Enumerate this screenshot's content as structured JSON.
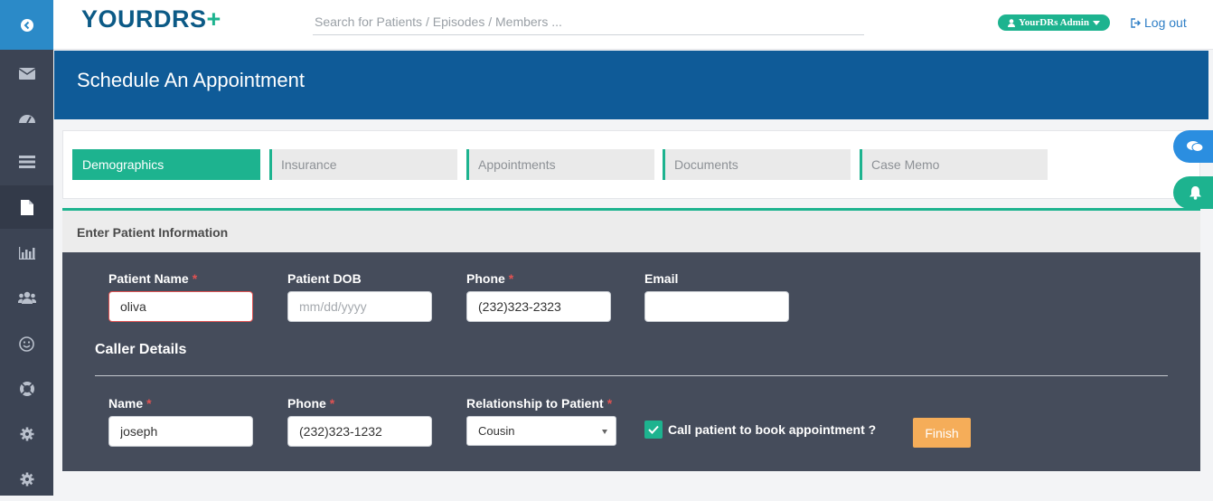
{
  "header": {
    "logo_primary": "YOURDRS",
    "logo_plus": "+",
    "search_placeholder": "Search for Patients / Episodes / Members ...",
    "admin_label": "YourDRs Admin",
    "logout_label": "Log out"
  },
  "sidebar": {
    "items": [
      "back-icon",
      "mail-icon",
      "dashboard-icon",
      "list-icon",
      "document-icon",
      "chart-icon",
      "users-icon",
      "smile-icon",
      "support-icon",
      "settings-icon",
      "settings-icon"
    ],
    "active_item": "document-icon"
  },
  "page": {
    "title": "Schedule An Appointment"
  },
  "tabs": [
    {
      "label": "Demographics",
      "active": true
    },
    {
      "label": "Insurance",
      "active": false
    },
    {
      "label": "Appointments",
      "active": false
    },
    {
      "label": "Documents",
      "active": false
    },
    {
      "label": "Case Memo",
      "active": false
    }
  ],
  "form": {
    "section_title": "Enter Patient Information",
    "patient": {
      "name_label": "Patient Name",
      "name_value": "oliva",
      "dob_label": "Patient DOB",
      "dob_placeholder": "mm/dd/yyyy",
      "phone_label": "Phone",
      "phone_value": "(232)323-2323",
      "email_label": "Email",
      "email_value": ""
    },
    "caller": {
      "section_title": "Caller Details",
      "name_label": "Name",
      "name_value": "joseph",
      "phone_label": "Phone",
      "phone_value": "(232)323-1232",
      "relationship_label": "Relationship to Patient",
      "relationship_value": "Cousin",
      "call_checkbox_label": "Call patient to book appointment ?",
      "call_checked": true,
      "finish_label": "Finish"
    },
    "required_marker": "*"
  },
  "colors": {
    "accent": "#1db38f",
    "header_blue": "#0f5b98",
    "sidebar": "#3c4454",
    "finish": "#f5ad59",
    "required": "#e05252"
  }
}
